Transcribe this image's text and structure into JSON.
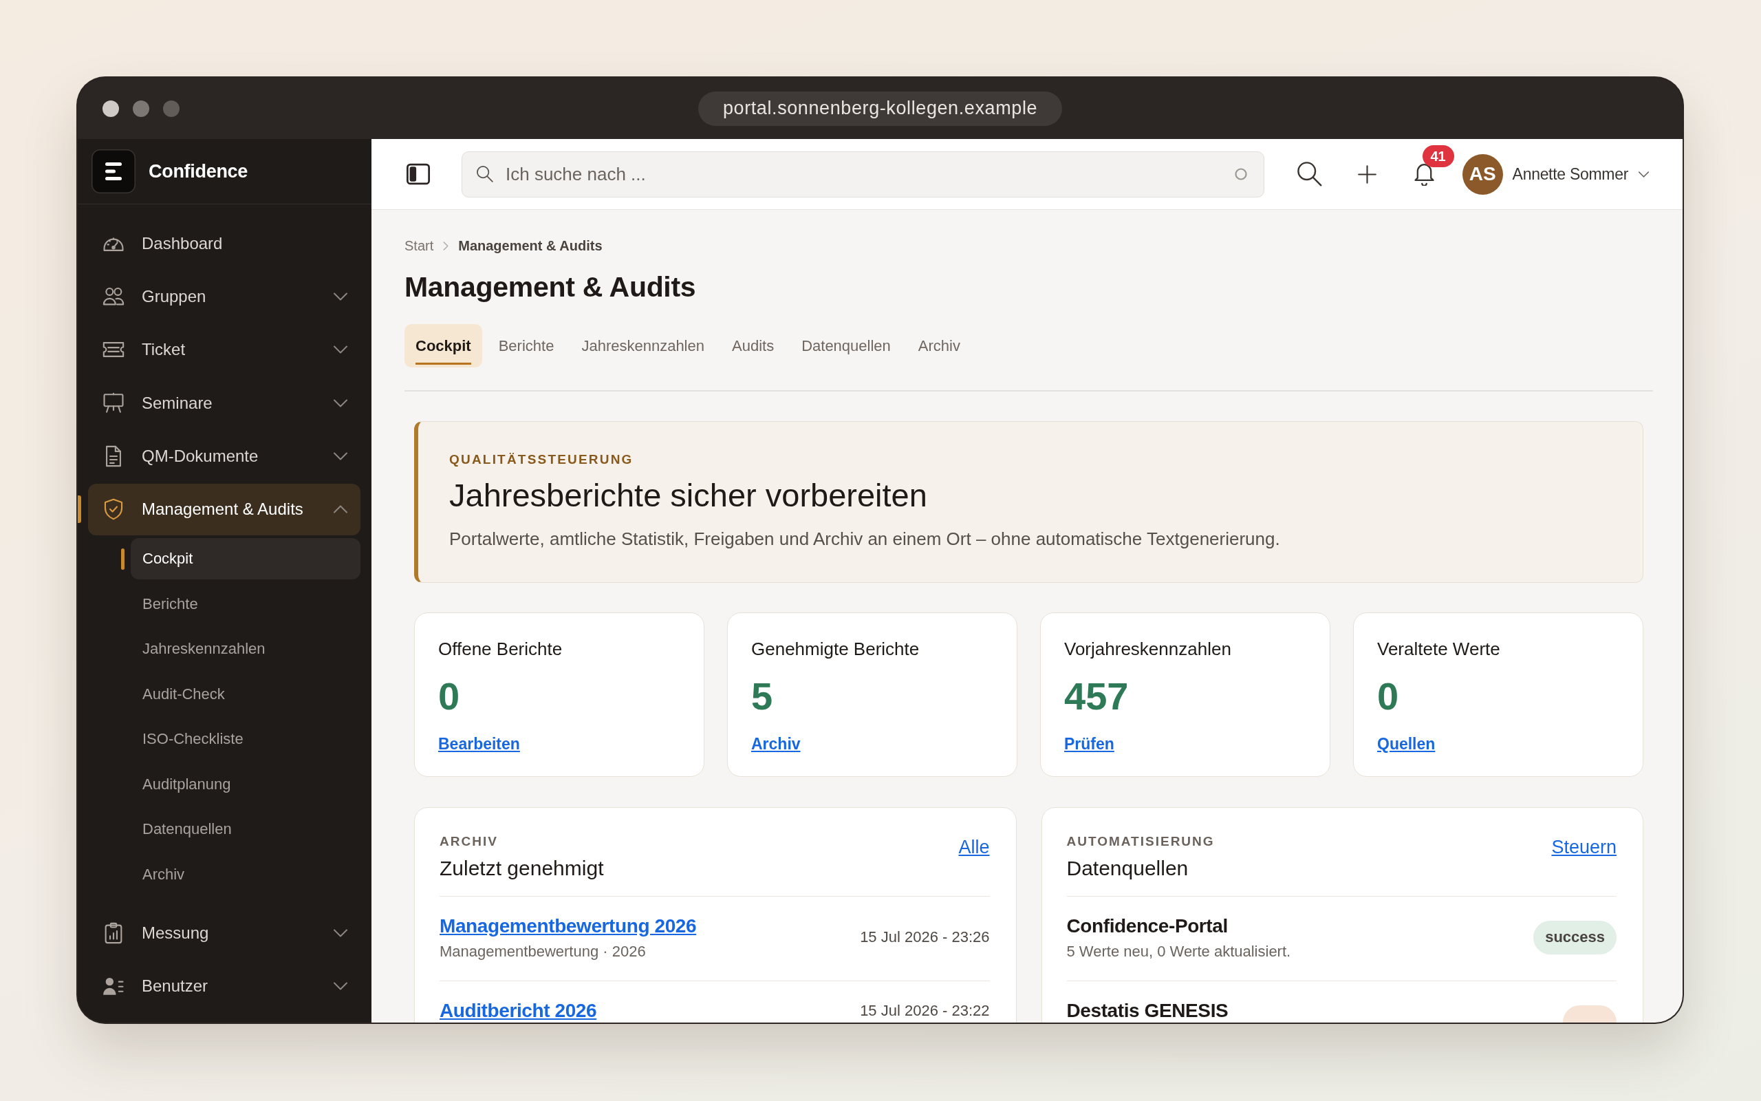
{
  "browser": {
    "url": "portal.sonnenberg-kollegen.example"
  },
  "sidebar": {
    "brand": "Confidence",
    "items": [
      {
        "label": "Dashboard",
        "expandable": false,
        "expanded": false,
        "selected": false
      },
      {
        "label": "Gruppen",
        "expandable": true,
        "expanded": false,
        "selected": false
      },
      {
        "label": "Ticket",
        "expandable": true,
        "expanded": false,
        "selected": false
      },
      {
        "label": "Seminare",
        "expandable": true,
        "expanded": false,
        "selected": false
      },
      {
        "label": "QM-Dokumente",
        "expandable": true,
        "expanded": false,
        "selected": false
      },
      {
        "label": "Management & Audits",
        "expandable": true,
        "expanded": true,
        "selected": true,
        "children": [
          {
            "label": "Cockpit",
            "selected": true
          },
          {
            "label": "Berichte",
            "selected": false
          },
          {
            "label": "Jahreskennzahlen",
            "selected": false
          },
          {
            "label": "Audit-Check",
            "selected": false
          },
          {
            "label": "ISO-Checkliste",
            "selected": false
          },
          {
            "label": "Auditplanung",
            "selected": false
          },
          {
            "label": "Datenquellen",
            "selected": false
          },
          {
            "label": "Archiv",
            "selected": false
          }
        ]
      },
      {
        "label": "Messung",
        "expandable": true,
        "expanded": false,
        "selected": false
      },
      {
        "label": "Benutzer",
        "expandable": true,
        "expanded": false,
        "selected": false
      }
    ]
  },
  "topbar": {
    "search": {
      "placeholder": "Ich suche nach ..."
    },
    "notifications": "41",
    "user": {
      "initials": "AS",
      "name": "Annette Sommer"
    }
  },
  "breadcrumb": [
    "Start",
    "Management & Audits"
  ],
  "title": "Management & Audits",
  "tabs": [
    {
      "label": "Cockpit",
      "selected": true
    },
    {
      "label": "Berichte",
      "selected": false
    },
    {
      "label": "Jahreskennzahlen",
      "selected": false
    },
    {
      "label": "Audits",
      "selected": false
    },
    {
      "label": "Datenquellen",
      "selected": false
    },
    {
      "label": "Archiv",
      "selected": false
    }
  ],
  "banner": {
    "kicker": "QUALITÄTSSTEUERUNG",
    "title": "Jahresberichte sicher vorbereiten",
    "text": "Portalwerte, amtliche Statistik, Freigaben und Archiv an einem Ort – ohne automatische Textgenerierung."
  },
  "stats": [
    {
      "label": "Offene Berichte",
      "value": "0",
      "link": "Bearbeiten"
    },
    {
      "label": "Genehmigte Berichte",
      "value": "5",
      "link": "Archiv"
    },
    {
      "label": "Vorjahreskennzahlen",
      "value": "457",
      "link": "Prüfen"
    },
    {
      "label": "Veraltete Werte",
      "value": "0",
      "link": "Quellen"
    }
  ],
  "panels": [
    {
      "kicker": "ARCHIV",
      "title": "Zuletzt genehmigt",
      "link": "Alle",
      "rows": [
        {
          "kind": "document",
          "title": "Managementbewertung 2026",
          "subtitle": "Managementbewertung · 2026",
          "date": "15 Jul 2026 - 23:26"
        },
        {
          "kind": "document",
          "title": "Auditbericht 2026",
          "date": "15 Jul 2026 - 23:22"
        }
      ]
    },
    {
      "kicker": "AUTOMATISIERUNG",
      "title": "Datenquellen",
      "link": "Steuern",
      "rows": [
        {
          "kind": "source",
          "title": "Confidence-Portal",
          "subtitle": "5 Werte neu, 0 Werte aktualisiert.",
          "status": "success",
          "color": "#e1efe7"
        },
        {
          "kind": "source",
          "title": "Destatis GENESIS",
          "color": "#f7e4d6"
        }
      ]
    }
  ]
}
